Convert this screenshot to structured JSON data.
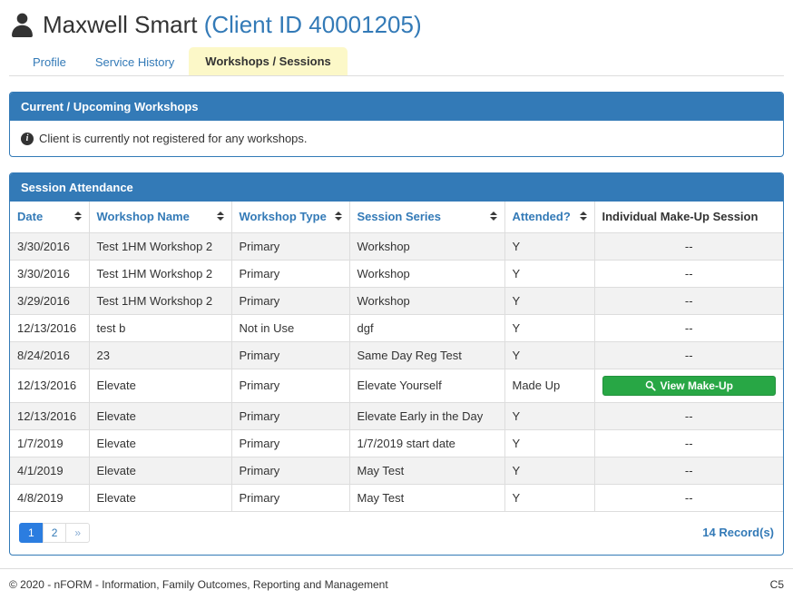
{
  "header": {
    "client_name": "Maxwell Smart",
    "client_id": "(Client ID 40001205)"
  },
  "tabs": {
    "profile": "Profile",
    "service_history": "Service History",
    "workshops": "Workshops / Sessions"
  },
  "upcoming": {
    "title": "Current / Upcoming Workshops",
    "message": "Client is currently not registered for any workshops."
  },
  "attendance": {
    "title": "Session Attendance",
    "columns": [
      "Date",
      "Workshop Name",
      "Workshop Type",
      "Session Series",
      "Attended?",
      "Individual Make-Up Session"
    ],
    "rows": [
      {
        "date": "3/30/2016",
        "workshop_name": "Test 1HM Workshop 2",
        "workshop_type": "Primary",
        "session_series": "Workshop",
        "attended": "Y",
        "makeup": "--"
      },
      {
        "date": "3/30/2016",
        "workshop_name": "Test 1HM Workshop 2",
        "workshop_type": "Primary",
        "session_series": "Workshop",
        "attended": "Y",
        "makeup": "--"
      },
      {
        "date": "3/29/2016",
        "workshop_name": "Test 1HM Workshop 2",
        "workshop_type": "Primary",
        "session_series": "Workshop",
        "attended": "Y",
        "makeup": "--"
      },
      {
        "date": "12/13/2016",
        "workshop_name": "test b",
        "workshop_type": "Not in Use",
        "session_series": "dgf",
        "attended": "Y",
        "makeup": "--"
      },
      {
        "date": "8/24/2016",
        "workshop_name": "23",
        "workshop_type": "Primary",
        "session_series": "Same Day Reg Test",
        "attended": "Y",
        "makeup": "--"
      },
      {
        "date": "12/13/2016",
        "workshop_name": "Elevate",
        "workshop_type": "Primary",
        "session_series": "Elevate Yourself",
        "attended": "Made Up",
        "makeup": "button"
      },
      {
        "date": "12/13/2016",
        "workshop_name": "Elevate",
        "workshop_type": "Primary",
        "session_series": "Elevate Early in the Day",
        "attended": "Y",
        "makeup": "--"
      },
      {
        "date": "1/7/2019",
        "workshop_name": "Elevate",
        "workshop_type": "Primary",
        "session_series": "1/7/2019 start date",
        "attended": "Y",
        "makeup": "--"
      },
      {
        "date": "4/1/2019",
        "workshop_name": "Elevate",
        "workshop_type": "Primary",
        "session_series": "May Test",
        "attended": "Y",
        "makeup": "--"
      },
      {
        "date": "4/8/2019",
        "workshop_name": "Elevate",
        "workshop_type": "Primary",
        "session_series": "May Test",
        "attended": "Y",
        "makeup": "--"
      }
    ],
    "view_makeup_label": "View Make-Up",
    "pagination": [
      "1",
      "2",
      "»"
    ],
    "active_page": "1",
    "record_count": "14 Record(s)"
  },
  "footer": {
    "copyright": "© 2020 - nFORM - Information, Family Outcomes, Reporting and Management",
    "page_code": "C5"
  },
  "colors": {
    "primary_blue": "#337ab7",
    "active_page_blue": "#2b7de0",
    "success_green": "#28a745",
    "tab_active_yellow": "#fcf8c8"
  }
}
